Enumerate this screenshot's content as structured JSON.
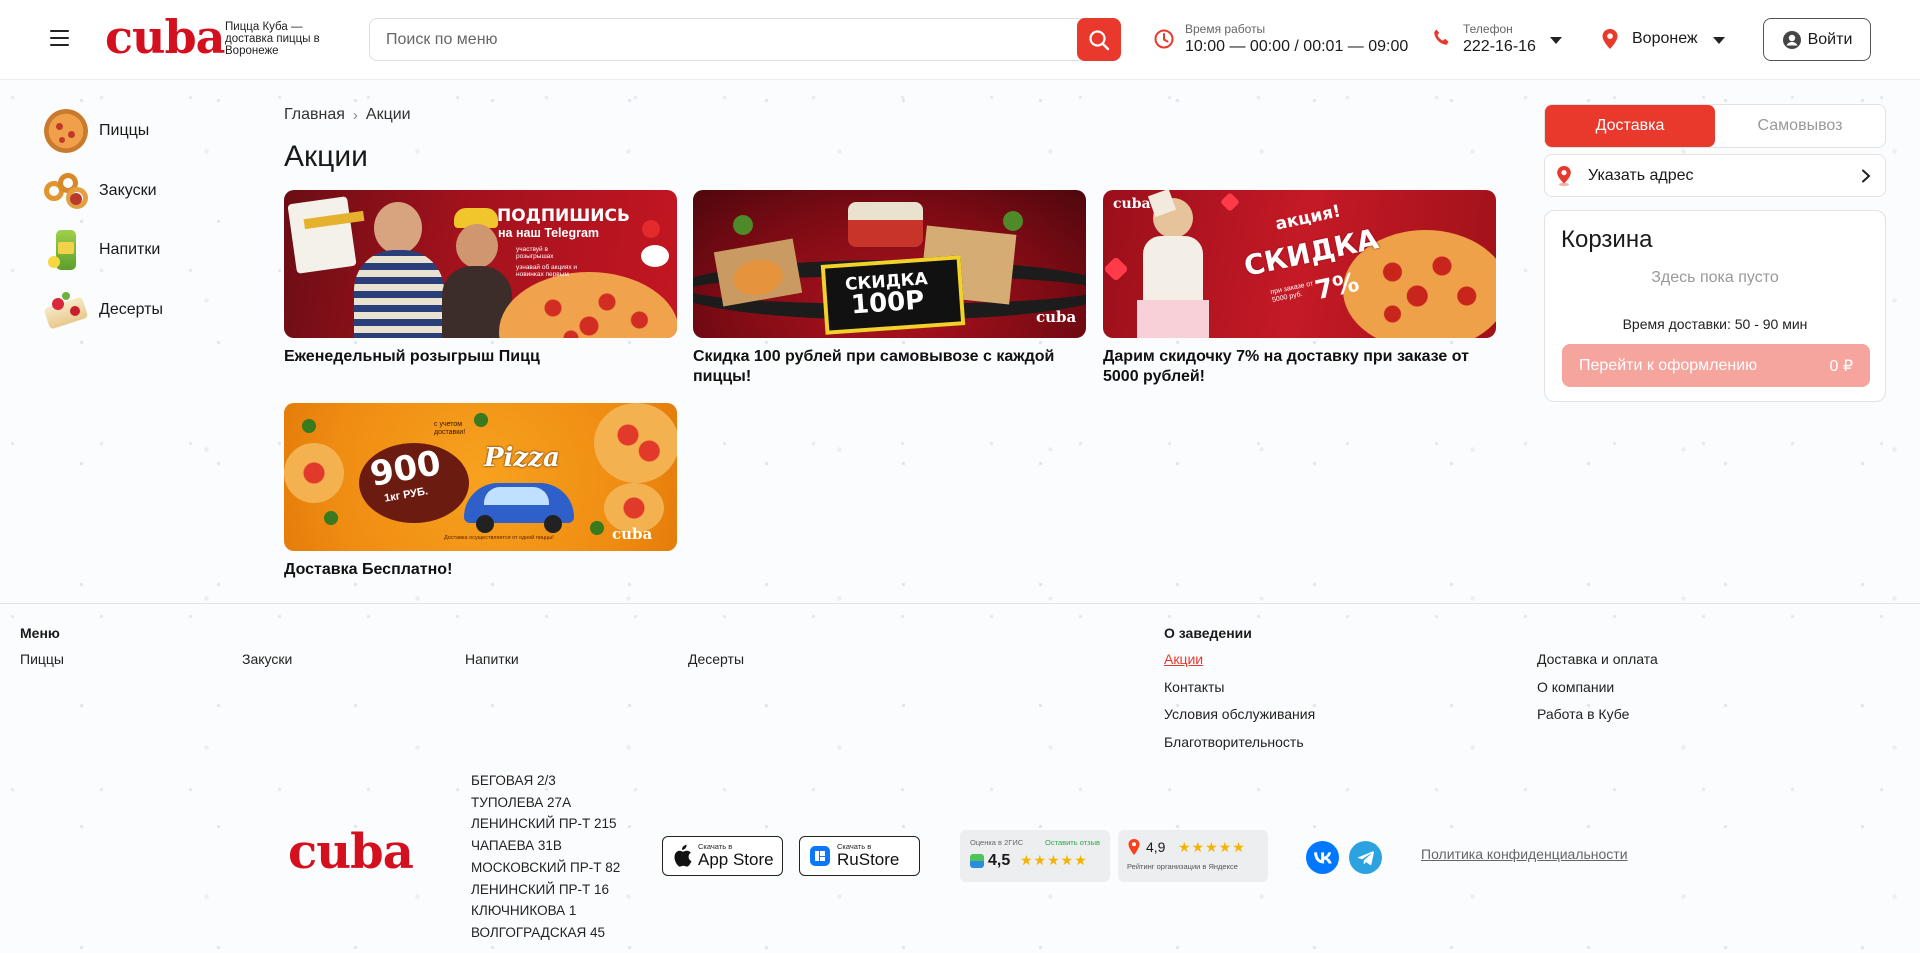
{
  "header": {
    "logo_text": "cuba",
    "tagline": "Пицца Куба — доставка пиццы в Воронеже",
    "search_placeholder": "Поиск по меню",
    "hours_label": "Время работы",
    "hours_value": "10:00 — 00:00 / 00:01 — 09:00",
    "phone_label": "Телефон",
    "phone_value": "222-16-16",
    "city": "Воронеж",
    "login_label": "Войти"
  },
  "sidebar": {
    "items": [
      {
        "label": "Пиццы",
        "icon": "pizza-icon"
      },
      {
        "label": "Закуски",
        "icon": "snacks-icon"
      },
      {
        "label": "Напитки",
        "icon": "drinks-icon"
      },
      {
        "label": "Десерты",
        "icon": "desserts-icon"
      }
    ]
  },
  "breadcrumb": {
    "home": "Главная",
    "current": "Акции"
  },
  "page_title": "Акции",
  "promos": [
    {
      "title": "Еженедельный розыгрыш Пицц",
      "banner_text_1": "ПОДПИШИСЬ",
      "banner_text_2": "на наш Telegram",
      "banner_small_1": "участвуй в розыгрышах",
      "banner_small_2": "узнавай об акциях и новинках первым"
    },
    {
      "title": "Скидка 100 рублей при самовывозе с каждой пиццы!",
      "banner_text_1": "СКИДКА",
      "banner_text_2": "100Р",
      "banner_logo": "cuba"
    },
    {
      "title": "Дарим скидочку 7% на доставку при заказе от 5000 рублей!",
      "banner_logo": "cuba",
      "banner_text_1": "акция!",
      "banner_text_2": "СКИДКА",
      "banner_small_1": "при заказе от 5000 руб.",
      "banner_text_3": "7%"
    },
    {
      "title": "Доставка Бесплатно!",
      "banner_text_1": "900",
      "banner_text_2": "1кг РУБ.",
      "banner_small_1": "с учетом доставки!",
      "banner_text_3": "Pizza",
      "banner_small_2": "Доставка осуществляется от одной пиццы!",
      "banner_logo": "cuba"
    }
  ],
  "order": {
    "tab_delivery": "Доставка",
    "tab_pickup": "Самовывоз",
    "address_label": "Указать адрес",
    "cart_title": "Корзина",
    "cart_empty": "Здесь пока пусто",
    "delivery_time": "Время доставки: 50 - 90 мин",
    "checkout_label": "Перейти к оформлению",
    "checkout_total": "0 ₽"
  },
  "footer": {
    "menu_heading": "Меню",
    "menu_links": [
      "Пиццы",
      "Закуски",
      "Напитки",
      "Десерты"
    ],
    "about_heading": "О заведении",
    "about_links": [
      "Акции",
      "Контакты",
      "Условия обслуживания",
      "Благотворительность"
    ],
    "info_links": [
      "Доставка и оплата",
      "О компании",
      "Работа в Кубе"
    ],
    "logo_text": "cuba",
    "addresses": [
      "БЕГОВАЯ 2/3",
      "ТУПОЛЕВА 27А",
      "ЛЕНИНСКИЙ ПР-Т 215",
      "ЧАПАЕВА 31В",
      "МОСКОВСКИЙ ПР-Т 82",
      "ЛЕНИНСКИЙ ПР-Т 16",
      "КЛЮЧНИКОВА 1",
      "ВОЛГОГРАДСКАЯ 45"
    ],
    "appstore_small": "Скачать в",
    "appstore_big": "App Store",
    "rustore_small": "Скачать в",
    "rustore_big": "RuStore",
    "gis_label": "Оценка в 2ГИС",
    "gis_review": "Оставить отзыв",
    "gis_rating": "4,5",
    "yandex_rating": "4,9",
    "yandex_label": "Рейтинг организации в Яндексе",
    "privacy": "Политика конфиденциальности"
  },
  "colors": {
    "accent": "#e8392c",
    "brand": "#d4101f"
  }
}
